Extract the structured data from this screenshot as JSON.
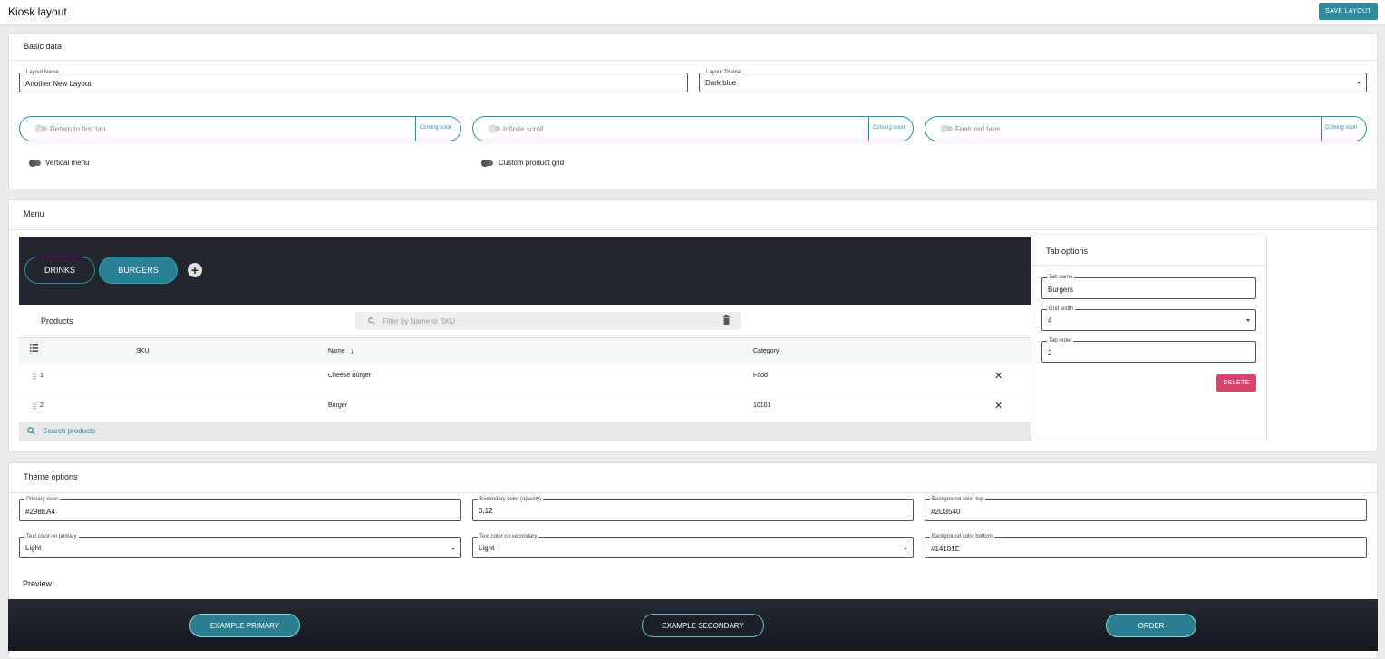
{
  "header": {
    "title": "Kiosk layout",
    "save_label": "SAVE LAYOUT"
  },
  "basic": {
    "title": "Basic data",
    "layout_name": {
      "label": "Layout Name",
      "value": "Another New Layout"
    },
    "layout_theme": {
      "label": "Layout Theme",
      "value": "Dark blue"
    },
    "toggles": [
      {
        "label": "Return to first tab",
        "badge": "Coming soon"
      },
      {
        "label": "Infinite scroll",
        "badge": "Coming soon"
      },
      {
        "label": "Featured tabs",
        "badge": "Coming soon"
      }
    ],
    "vertical_menu": "Vertical menu",
    "custom_grid": "Custom product grid"
  },
  "menu": {
    "title": "Menu",
    "tabs": [
      "DRINKS",
      "BURGERS"
    ],
    "add_symbol": "+",
    "products_title": "Products",
    "filter_placeholder": "Filter by Name or SKU",
    "columns": {
      "sku": "SKU",
      "name": "Name",
      "category": "Category"
    },
    "sort_arrow": "↓",
    "rows": [
      {
        "sku": "1",
        "name": "Cheese Burger",
        "category": "Food"
      },
      {
        "sku": "2",
        "name": "Burger",
        "category": "10101"
      }
    ],
    "search_products": "Search products"
  },
  "tab_options": {
    "title": "Tab options",
    "tab_name": {
      "label": "Tab name",
      "value": "Burgers"
    },
    "grid_width": {
      "label": "Grid width",
      "value": "4"
    },
    "tab_order": {
      "label": "Tab order",
      "value": "2"
    },
    "delete_label": "DELETE"
  },
  "theme": {
    "title": "Theme options",
    "primary_color": {
      "label": "Primary color",
      "value": "#298EA4"
    },
    "secondary_color": {
      "label": "Secondary color (opacity)",
      "value": "0,12"
    },
    "bg_top": {
      "label": "Background color top",
      "value": "#2D3540"
    },
    "text_primary": {
      "label": "Text color on primary",
      "value": "Light"
    },
    "text_secondary": {
      "label": "Text color on secondary",
      "value": "Light"
    },
    "bg_bottom": {
      "label": "Background color bottom",
      "value": "#14181E"
    },
    "preview_title": "Preview",
    "preview_buttons": {
      "primary": "EXAMPLE PRIMARY",
      "secondary": "EXAMPLE SECONDARY",
      "order": "ORDER"
    }
  },
  "colors": {
    "accent": "#2F8BA0",
    "danger": "#D6456E",
    "dark_bg": "#22272E"
  }
}
